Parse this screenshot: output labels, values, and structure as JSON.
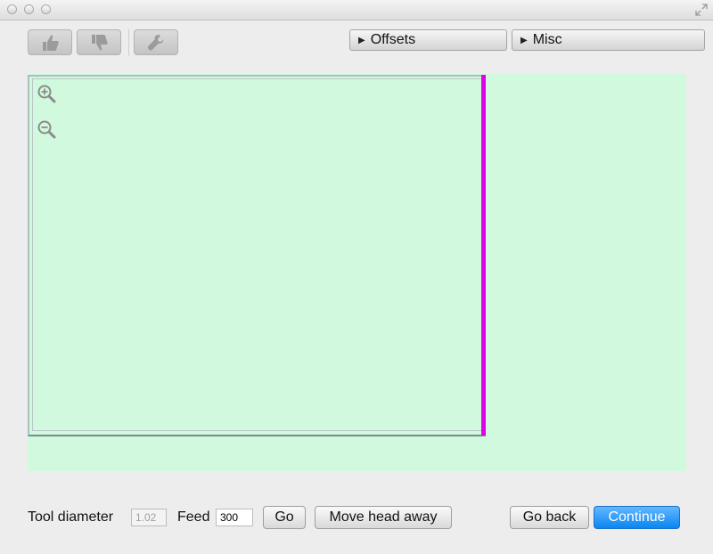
{
  "window": {
    "controls": [
      "close-icon",
      "minimize-icon",
      "zoom-icon"
    ],
    "resize_icon": "fullscreen-icon"
  },
  "toolbar": {
    "icons": [
      "thumbs-up-icon",
      "thumbs-down-icon",
      "wrench-icon"
    ],
    "panels": [
      {
        "label": "Offsets",
        "state": "collapsed"
      },
      {
        "label": "Misc",
        "state": "collapsed"
      }
    ]
  },
  "canvas": {
    "background": "#d0f9de",
    "marker_color": "#e000ea",
    "zoom_in_icon": "zoom-in-icon",
    "zoom_out_icon": "zoom-out-icon"
  },
  "footer": {
    "tool_diameter_label": "Tool diameter",
    "tool_diameter_value": "1.02",
    "feed_label": "Feed",
    "feed_value": "300",
    "go_label": "Go",
    "move_head_label": "Move head away",
    "go_back_label": "Go back",
    "continue_label": "Continue"
  },
  "colors": {
    "accent": "#0a86f0"
  }
}
